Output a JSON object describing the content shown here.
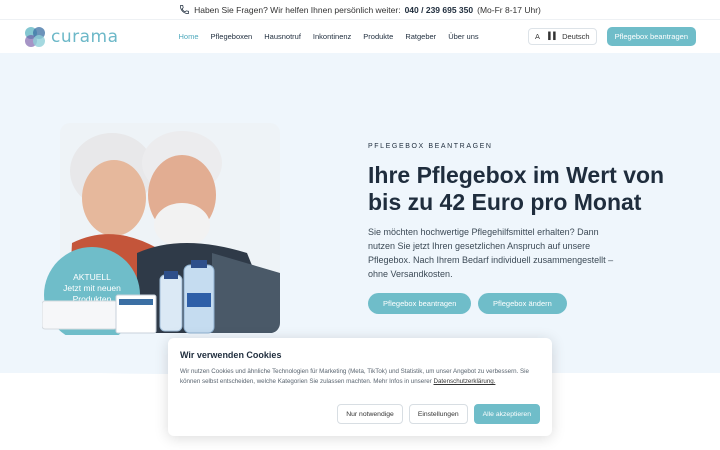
{
  "topbar": {
    "text": "Haben Sie Fragen? Wir helfen Ihnen persönlich weiter:",
    "phone": "040 / 239 695 350",
    "hours": "(Mo-Fr 8-17 Uhr)"
  },
  "nav": {
    "logo": "curama",
    "items": [
      "Home",
      "Pflegeboxen",
      "Hausnotruf",
      "Inkontinenz",
      "Produkte",
      "Ratgeber",
      "Über uns"
    ],
    "active": "Home",
    "language": "Deutsch",
    "cta": "Pflegebox beantragen"
  },
  "hero": {
    "eyebrow": "PFLEGEBOX BEANTRAGEN",
    "headline": "Ihre Pflegebox im Wert von bis zu 42 Euro pro Monat",
    "lead": "Sie möchten hochwertige Pflegehilfsmittel erhalten? Dann nutzen Sie jetzt Ihren gesetzlichen Anspruch auf unsere Pflegebox. Nach Ihrem Bedarf individuell zusammengestellt – ohne Versandkosten.",
    "btn_apply": "Pflegebox beantragen",
    "btn_change": "Pflegebox ändern",
    "badge_line1": "AKTUELL",
    "badge_line2": "Jetzt mit neuen",
    "badge_line3": "Produkten"
  },
  "cookie": {
    "title": "Wir verwenden Cookies",
    "text": "Wir nutzen Cookies und ähnliche Technologien für Marketing (Meta, TikTok) und Statistik, um unser Angebot zu verbessern. Sie können selbst entscheiden, welche Kategorien Sie zulassen machten. Mehr Infos in unserer",
    "link": "Datenschutzerklärung.",
    "btn_necessary": "Nur notwendige",
    "btn_settings": "Einstellungen",
    "btn_accept": "Alle akzeptieren"
  },
  "colors": {
    "accent": "#6fbdc9",
    "hero_bg": "#eff6fc",
    "text_dark": "#1f2d3d"
  }
}
